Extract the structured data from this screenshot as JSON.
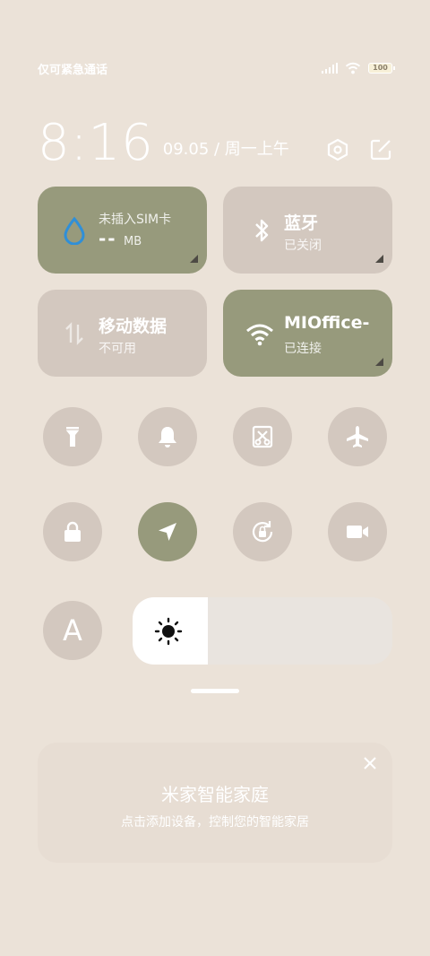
{
  "status": {
    "carrier_text": "仅可紧急通话",
    "battery": "100"
  },
  "header": {
    "time": "8:16",
    "date": "09.05 / 周一上午"
  },
  "tiles": [
    {
      "title": "未插入SIM卡",
      "value": "--",
      "unit": "MB",
      "state": "active"
    },
    {
      "title": "蓝牙",
      "sub": "已关闭",
      "state": "inactive"
    },
    {
      "title": "移动数据",
      "sub": "不可用",
      "state": "inactive"
    },
    {
      "title": "MIOffice-",
      "sub": "已连接",
      "state": "active"
    }
  ],
  "toggles_row1": [
    {
      "icon": "flashlight-icon",
      "state": "off"
    },
    {
      "icon": "bell-icon",
      "state": "off"
    },
    {
      "icon": "screenshot-icon",
      "state": "off"
    },
    {
      "icon": "airplane-icon",
      "state": "off"
    }
  ],
  "toggles_row2": [
    {
      "icon": "lock-icon",
      "state": "off"
    },
    {
      "icon": "location-icon",
      "state": "on"
    },
    {
      "icon": "rotation-lock-icon",
      "state": "off"
    },
    {
      "icon": "video-camera-icon",
      "state": "off"
    }
  ],
  "font_toggle": {
    "icon": "font-a-icon",
    "label": "A"
  },
  "brightness": {
    "level": 0.29
  },
  "smart_home_card": {
    "title": "米家智能家庭",
    "subtitle": "点击添加设备，控制您的智能家居"
  },
  "colors": {
    "background": "#ebe2d8",
    "active": "#979a7c",
    "inactive": "#d3c8bf",
    "water_drop": "#2f8fd8"
  }
}
